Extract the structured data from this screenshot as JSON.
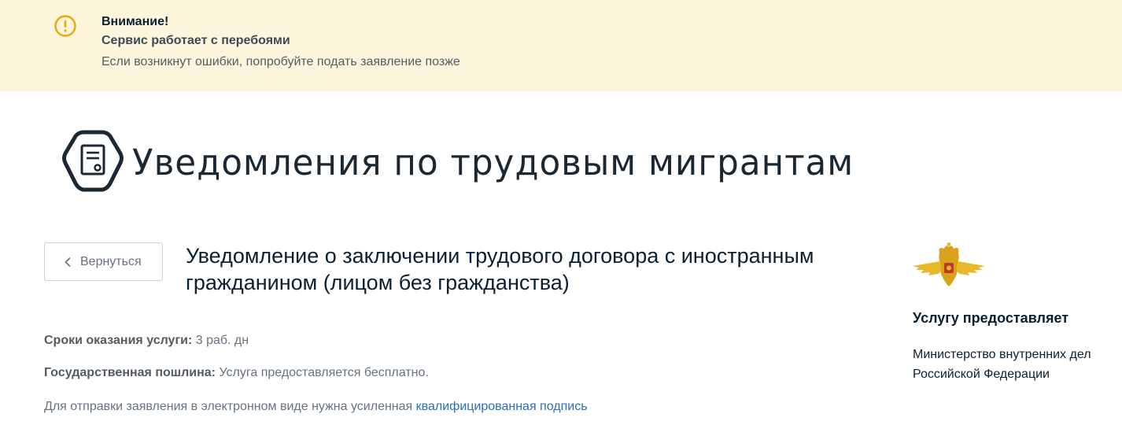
{
  "alert": {
    "icon": "warning-circle-icon",
    "title": "Внимание!",
    "subtitle": "Сервис работает с перебоями",
    "text": "Если возникнут ошибки, попробуйте подать заявление позже",
    "background_color": "#fdf6dc",
    "icon_color": "#f0a500"
  },
  "hero": {
    "icon": "document-hexagon-icon",
    "title": "Уведомления по трудовым мигрантам"
  },
  "back_button": {
    "icon": "chevron-left-icon",
    "label": "Вернуться"
  },
  "service": {
    "title": "Уведомление о заключении трудового договора с иностранным гражданином (лицом без гражданства)"
  },
  "info": {
    "term_label": "Сроки оказания услуги:",
    "term_value": "3 раб. дн",
    "fee_label": "Государственная пошлина:",
    "fee_value": "Услуга предоставляется бесплатно.",
    "signature_text": "Для отправки заявления в электронном виде нужна усиленная",
    "signature_link": "квалифицированная подпись",
    "link_color": "#2a6fb5"
  },
  "provider": {
    "emblem": "mvd-eagle-emblem-icon",
    "heading": "Услугу предоставляет",
    "name": "Министерство внутренних дел Российской Федерации"
  }
}
